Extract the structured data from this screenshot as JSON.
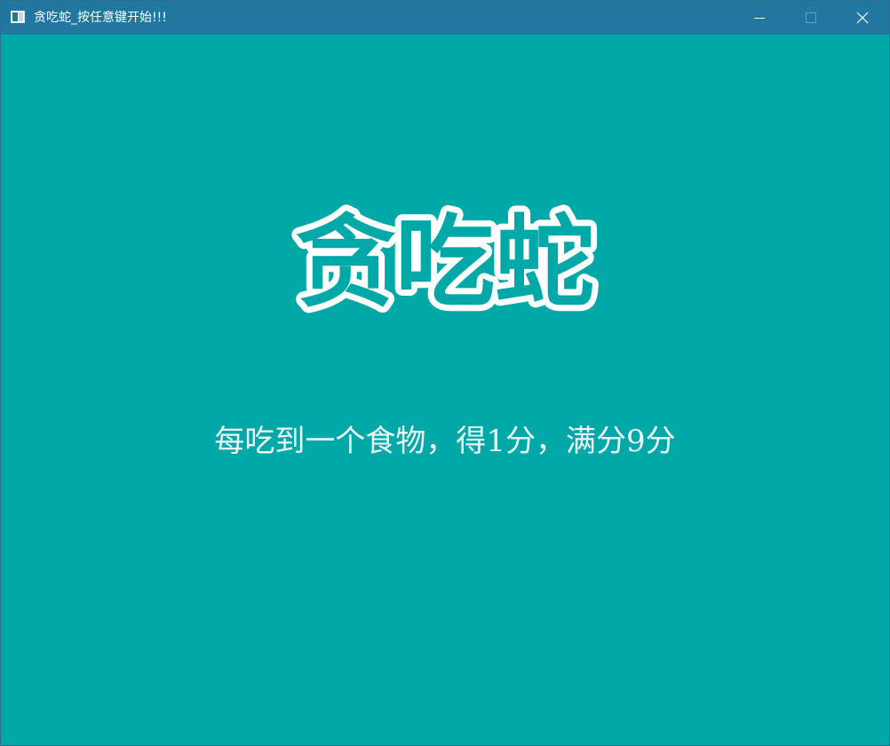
{
  "window": {
    "title": "贪吃蛇_按任意键开始!!!",
    "icon": "app-window-icon",
    "controls": {
      "minimize_icon": "minimize-icon",
      "maximize_icon": "maximize-icon",
      "close_icon": "close-icon"
    },
    "colors": {
      "titlebar": "#2277a0",
      "background": "#01a8a8",
      "text": "#ffffff"
    }
  },
  "game": {
    "logo_text": "贪吃蛇",
    "instructions": "每吃到一个食物，得1分，满分9分"
  }
}
